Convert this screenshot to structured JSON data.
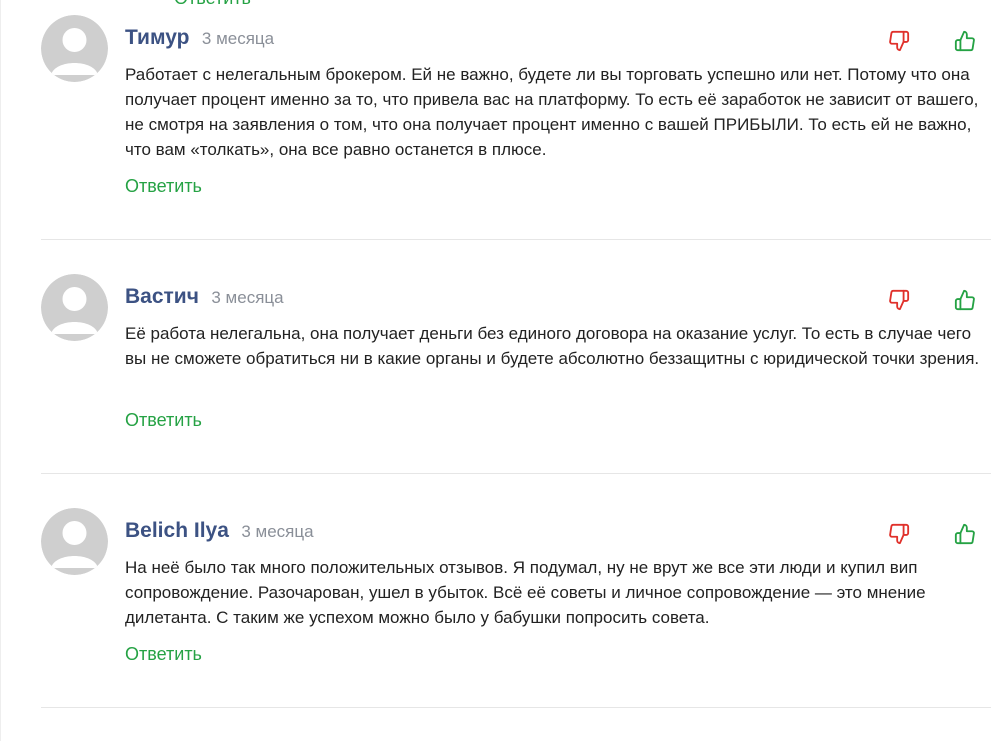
{
  "top_reply_label": "Ответить",
  "comments": [
    {
      "author": "Тимур",
      "time": "3 месяца",
      "text": "Работает с нелегальным брокером. Ей не важно, будете ли вы торговать успешно или нет. Потому что она получает процент именно за то, что привела вас на платформу. То есть её заработок не зависит от вашего, не смотря на заявления о том, что она получает процент именно с вашей ПРИБЫЛИ. То есть ей не важно, что вам «толкать», она все равно останется в плюсе.",
      "reply_label": "Ответить"
    },
    {
      "author": "Вастич",
      "time": "3 месяца",
      "text": "Её работа нелегальна, она получает деньги без единого договора на оказание услуг. То есть в случае чего вы не сможете обратиться ни в какие органы и будете абсолютно беззащитны с юридической точки зрения.",
      "reply_label": "Ответить"
    },
    {
      "author": "Belich Ilya",
      "time": "3 месяца",
      "text": "На неё было так много положительных отзывов. Я подумал, ну не врут же все эти люди и купил вип сопровождение. Разочарован, ушел в убыток. Всё её советы и личное сопровождение — это мнение дилетанта. С таким же успехом можно было у бабушки попросить совета.",
      "reply_label": "Ответить"
    }
  ],
  "icons": {
    "avatar": "default-avatar-icon",
    "dislike": "thumbs-down-icon",
    "like": "thumbs-up-icon"
  },
  "colors": {
    "author": "#3c5283",
    "reply": "#25a244",
    "dislike": "#e0312b",
    "like": "#25a244",
    "avatar_bg": "#cfcfcf",
    "avatar_fg": "#ffffff"
  }
}
